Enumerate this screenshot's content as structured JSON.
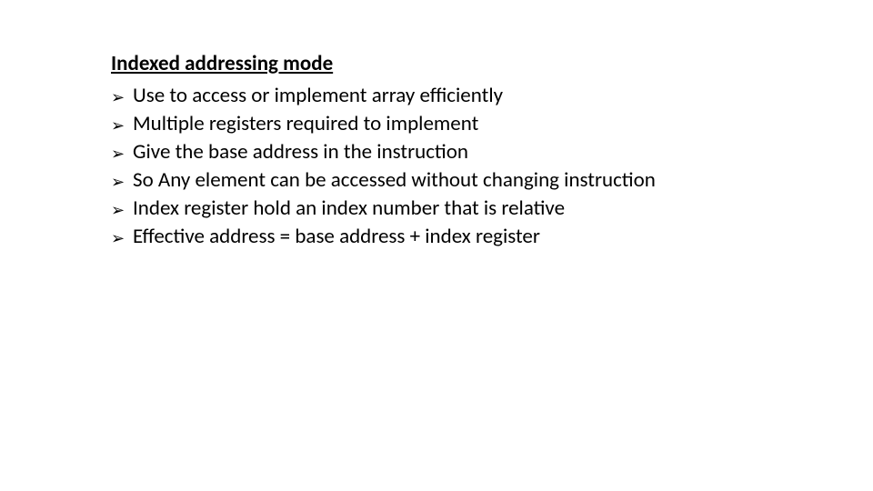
{
  "heading": "Indexed addressing mode",
  "bullets": [
    "Use to access or implement array efficiently",
    "Multiple registers required to implement",
    "Give the base address in the instruction",
    "So Any element can be accessed without changing instruction",
    "Index register hold an index number that is relative",
    "Effective address = base address + index register"
  ],
  "bullet_glyph": "➢"
}
